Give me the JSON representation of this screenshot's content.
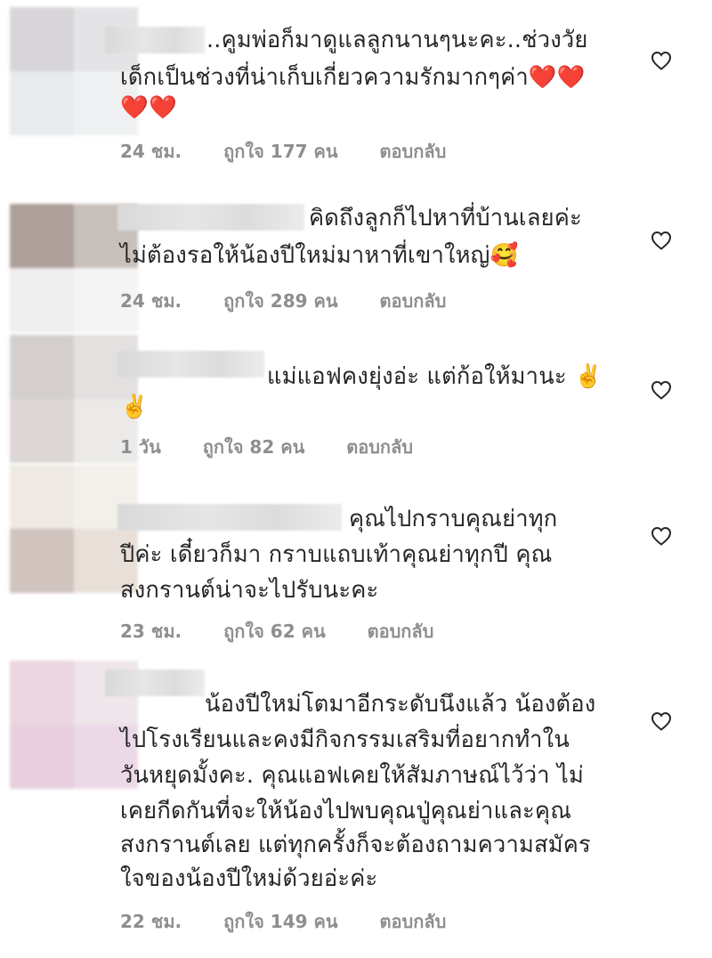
{
  "comments": [
    {
      "lines": [
        "..คูมพ่อก็มาดูแลลูกนานๆนะคะ..ช่วงวัย",
        "เด็กเป็นช่วงที่น่าเก็บเกี่ยวความรักมากๆค่า❤️❤️",
        "❤️❤️"
      ],
      "time": "24 ชม.",
      "likes": "ถูกใจ 177 คน",
      "reply": "ตอบกลับ"
    },
    {
      "lines": [
        "คิดถึงลูกก็ไปหาที่บ้านเลยค่ะ",
        "ไม่ต้องรอให้น้องปีใหม่มาหาที่เขาใหญ่🥰"
      ],
      "time": "24 ชม.",
      "likes": "ถูกใจ 289 คน",
      "reply": "ตอบกลับ"
    },
    {
      "lines": [
        "แม่แอฟคงยุ่งอ่ะ แต่ก้อให้มานะ ✌️",
        "✌️"
      ],
      "time": "1 วัน",
      "likes": "ถูกใจ 82 คน",
      "reply": "ตอบกลับ"
    },
    {
      "lines": [
        "คุณไปกราบคุณย่าทุก",
        "ปีค่ะ เดี๋ยวก็มา กราบแถบเท้าคุณย่าทุกปี คุณ",
        "สงกรานต์น่าจะไปรับนะคะ"
      ],
      "time": "23 ชม.",
      "likes": "ถูกใจ 62 คน",
      "reply": "ตอบกลับ"
    },
    {
      "lines": [
        "น้องปีใหม่โตมาอีกระดับนึงแล้ว น้องต้อง",
        "ไปโรงเรียนและคงมีกิจกรรมเสริมที่อยากทำใน",
        "วันหยุดมั้งคะ. คุณแอฟเคยให้สัมภาษณ์ไว้ว่า ไม่",
        "เคยกีดกันที่จะให้น้องไปพบคุณปู่คุณย่าและคุณ",
        "สงกรานต์เลย แต่ทุกครั้งก็จะต้องถามความสมัคร",
        "ใจของน้องปีใหม่ด้วยอ่ะค่ะ"
      ],
      "time": "22 ชม.",
      "likes": "ถูกใจ 149 คน",
      "reply": "ตอบกลับ"
    }
  ],
  "icons": {
    "like": "heart-outline-icon"
  },
  "colors": {
    "text": "#262626",
    "meta": "#8e8e8e",
    "icon": "#262626"
  }
}
